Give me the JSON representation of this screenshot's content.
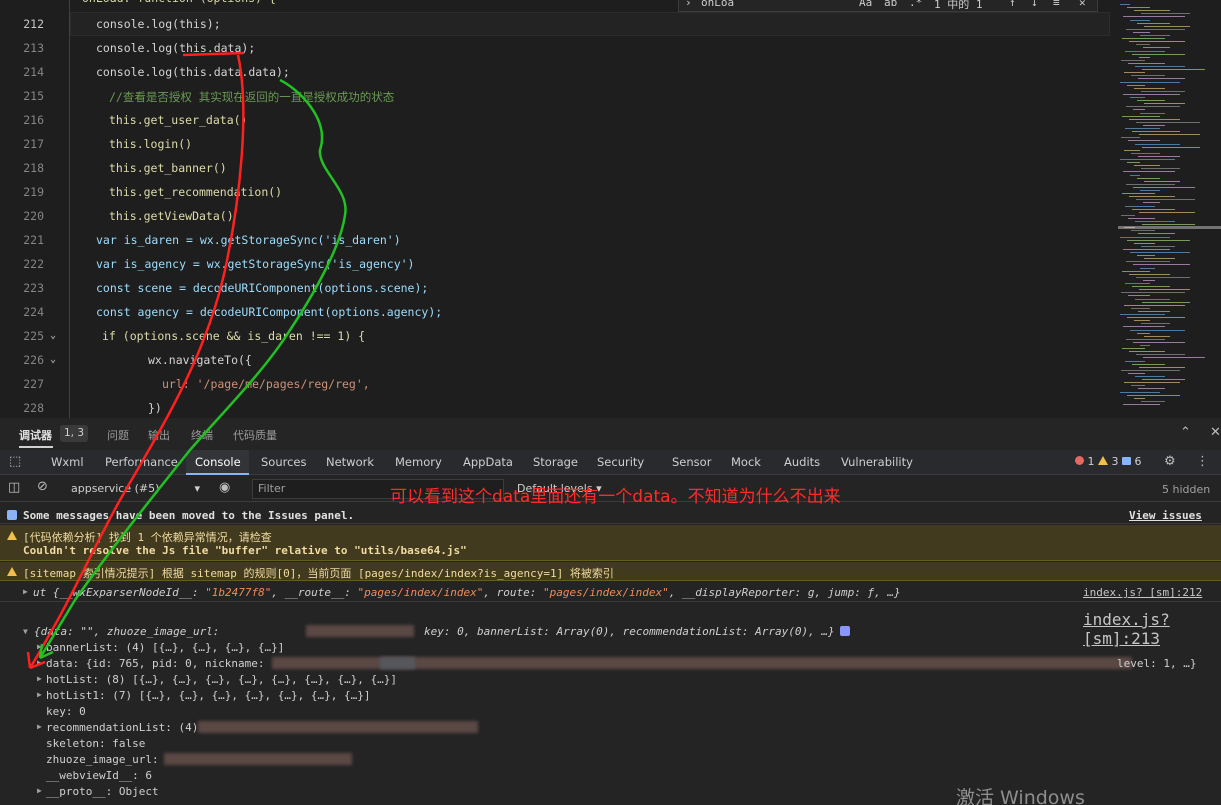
{
  "editor": {
    "lines": [
      {
        "no": "212",
        "code": "console.log(this);"
      },
      {
        "no": "213",
        "code": "console.log(this.data);"
      },
      {
        "no": "214",
        "code": "console.log(this.data.data);"
      },
      {
        "no": "215",
        "code": "//查看是否授权 其实现在返回的一直是授权成功的状态"
      },
      {
        "no": "216",
        "code": "this.get_user_data()"
      },
      {
        "no": "217",
        "code": "this.login()"
      },
      {
        "no": "218",
        "code": "this.get_banner()"
      },
      {
        "no": "219",
        "code": "this.get_recommendation()"
      },
      {
        "no": "220",
        "code": "this.getViewData()"
      },
      {
        "no": "221",
        "code": "var is_daren = wx.getStorageSync('is_daren')"
      },
      {
        "no": "222",
        "code": "var is_agency = wx.getStorageSync('is_agency')"
      },
      {
        "no": "223",
        "code": "const scene = decodeURIComponent(options.scene);"
      },
      {
        "no": "224",
        "code": "const agency = decodeURIComponent(options.agency);"
      },
      {
        "no": "225",
        "code": "if (options.scene && is_daren !== 1) {"
      },
      {
        "no": "226",
        "code": "wx.navigateTo({"
      },
      {
        "no": "227",
        "code": "url: '/page/me/pages/reg/reg',"
      },
      {
        "no": "228",
        "code": "})"
      }
    ],
    "top_partial": "onLoad: function (options) {",
    "find": {
      "query": "onLoa",
      "result": "1 中的 1"
    }
  },
  "panel_tabs": {
    "debugger": "调试器",
    "badge": "1, 3",
    "issues": "问题",
    "output": "输出",
    "terminal": "终端",
    "code_quality": "代码质量"
  },
  "devtools_tabs": [
    "Wxml",
    "Performance",
    "Console",
    "Sources",
    "Network",
    "Memory",
    "AppData",
    "Storage",
    "Security",
    "Sensor",
    "Mock",
    "Audits",
    "Vulnerability"
  ],
  "counts": {
    "errors": "1",
    "warnings": "3",
    "info": "6"
  },
  "toolbar": {
    "context": "appservice (#5)",
    "filter_placeholder": "Filter",
    "levels": "Default levels ▾",
    "hidden": "5 hidden"
  },
  "annotation": "可以看到这个data里面还有一个data。不知道为什么不出来",
  "console": {
    "issues_msg": "Some messages have been moved to the Issues panel.",
    "view_issues": "View issues",
    "warn1_line1": "[代码依赖分析] 找到 1 个依赖异常情况，请检查",
    "warn1_line2": "Couldn't resolve the Js file \"buffer\" relative to \"utils/base64.js\"",
    "warn2": "[sitemap 索引情况提示] 根据 sitemap 的规则[0]，当前页面 [pages/index/index?is_agency=1] 将被索引",
    "log1_prefix": "ut {__wxExparserNodeId__: ",
    "log1_id": "\"1b2477f8\"",
    "log1_route_k": ", __route__: ",
    "log1_route_v": "\"pages/index/index\"",
    "log1_route2_k": ", route: ",
    "log1_route2_v": "\"pages/index/index\"",
    "log1_rest": ", __displayReporter: g, jump: ƒ, …}",
    "log1_src": "index.js? [sm]:212",
    "log2_src": "index.js? [sm]:213",
    "obj_head_a": "{data: \"\", zhuoze_image_url: ",
    "obj_head_b": "key: 0, bannerList: Array(0), recommendationList: Array(0), …}",
    "props": {
      "bannerList": "bannerList: (4) [{…}, {…}, {…}, {…}]",
      "data_a": "data: {id: 765, pid: 0, nickname: ",
      "data_b": "level: 1, …}",
      "hotList": "hotList: (8) [{…}, {…}, {…}, {…}, {…}, {…}, {…}, {…}]",
      "hotList1": "hotList1: (7) [{…}, {…}, {…}, {…}, {…}, {…}, {…}]",
      "key": "key: 0",
      "recommendationList": "recommendationList: (4) ",
      "skeleton": "skeleton: false",
      "zhuoze": "zhuoze_image_url: ",
      "webview": "__webviewId__: 6",
      "proto": "__proto__: Object"
    }
  },
  "watermark": "激活 Windows"
}
